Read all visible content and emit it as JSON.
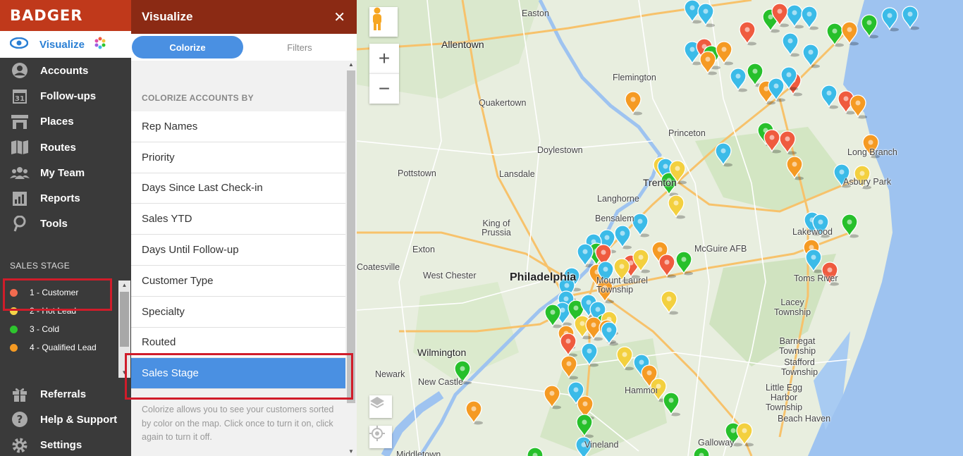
{
  "brand": {
    "logo_text": "BADGER"
  },
  "nav": {
    "visualize_label": "Visualize",
    "items": [
      {
        "label": "Accounts",
        "icon": "person-circle-icon"
      },
      {
        "label": "Follow-ups",
        "icon": "calendar-icon",
        "icon_text": "31"
      },
      {
        "label": "Places",
        "icon": "storefront-icon"
      },
      {
        "label": "Routes",
        "icon": "map-icon"
      },
      {
        "label": "My Team",
        "icon": "team-icon"
      },
      {
        "label": "Reports",
        "icon": "reports-icon"
      },
      {
        "label": "Tools",
        "icon": "tools-icon"
      }
    ],
    "bottom_items": [
      {
        "label": "Referrals",
        "icon": "gift-icon"
      },
      {
        "label": "Help & Support",
        "icon": "help-icon",
        "icon_text": "?"
      },
      {
        "label": "Settings",
        "icon": "gear-icon"
      }
    ]
  },
  "sales_stage": {
    "title": "SALES STAGE",
    "items": [
      {
        "label": "1 - Customer",
        "color": "#f26b4f"
      },
      {
        "label": "2 - Hot Lead",
        "color": "#f5d547"
      },
      {
        "label": "3 - Cold",
        "color": "#2ec52e"
      },
      {
        "label": "4 - Qualified Lead",
        "color": "#f59a23"
      }
    ]
  },
  "panel": {
    "title": "Visualize",
    "close_glyph": "✕",
    "tabs": [
      {
        "label": "Colorize",
        "active": true
      },
      {
        "label": "Filters",
        "active": false
      }
    ],
    "colorize_heading": "COLORIZE ACCOUNTS BY",
    "options": [
      "Rep Names",
      "Priority",
      "Days Since Last Check-in",
      "Sales YTD",
      "Days Until Follow-up",
      "Customer Type",
      "Specialty",
      "Routed",
      "Sales Stage"
    ],
    "selected_option": "Sales Stage",
    "note": "Colorize allows you to see your customers sorted by color on the map. Click once to turn it on, click again to turn it off."
  },
  "map": {
    "labels": [
      {
        "text": "Easton",
        "kind": "small"
      },
      {
        "text": "Allentown",
        "kind": "mid"
      },
      {
        "text": "Quakertown",
        "kind": "small"
      },
      {
        "text": "Flemington",
        "kind": "small"
      },
      {
        "text": "Princeton",
        "kind": "small"
      },
      {
        "text": "Doylestown",
        "kind": "small"
      },
      {
        "text": "Lansdale",
        "kind": "small"
      },
      {
        "text": "Pottstown",
        "kind": "small"
      },
      {
        "text": "Trenton",
        "kind": "mid"
      },
      {
        "text": "Langhorne",
        "kind": "small"
      },
      {
        "text": "King of Prussia",
        "kind": "small"
      },
      {
        "text": "Bensalem",
        "kind": "small"
      },
      {
        "text": "Exton",
        "kind": "small"
      },
      {
        "text": "West Chester",
        "kind": "small"
      },
      {
        "text": "Coatesville",
        "kind": "small"
      },
      {
        "text": "Philadelphia",
        "kind": "big"
      },
      {
        "text": "Mount Laurel Township",
        "kind": "small"
      },
      {
        "text": "McGuire AFB",
        "kind": "small"
      },
      {
        "text": "Long Branch",
        "kind": "small"
      },
      {
        "text": "Asbury Park",
        "kind": "small"
      },
      {
        "text": "Lakewood",
        "kind": "small"
      },
      {
        "text": "Toms River",
        "kind": "small"
      },
      {
        "text": "Lacey Township",
        "kind": "small"
      },
      {
        "text": "Barnegat Township",
        "kind": "small"
      },
      {
        "text": "Stafford Township",
        "kind": "small"
      },
      {
        "text": "Little Egg Harbor Township",
        "kind": "small"
      },
      {
        "text": "Beach Haven",
        "kind": "small"
      },
      {
        "text": "Galloway",
        "kind": "small"
      },
      {
        "text": "Hammonton",
        "kind": "small"
      },
      {
        "text": "Wilmington",
        "kind": "mid"
      },
      {
        "text": "Newark",
        "kind": "small"
      },
      {
        "text": "New Castle",
        "kind": "small"
      },
      {
        "text": "Vineland",
        "kind": "small"
      },
      {
        "text": "Middletown",
        "kind": "small"
      }
    ],
    "pin_colors": {
      "customer": "#ef5b3f",
      "hot": "#f3d03f",
      "cold": "#27c02b",
      "qualified": "#f59a23",
      "other": "#3bbbe8"
    }
  }
}
